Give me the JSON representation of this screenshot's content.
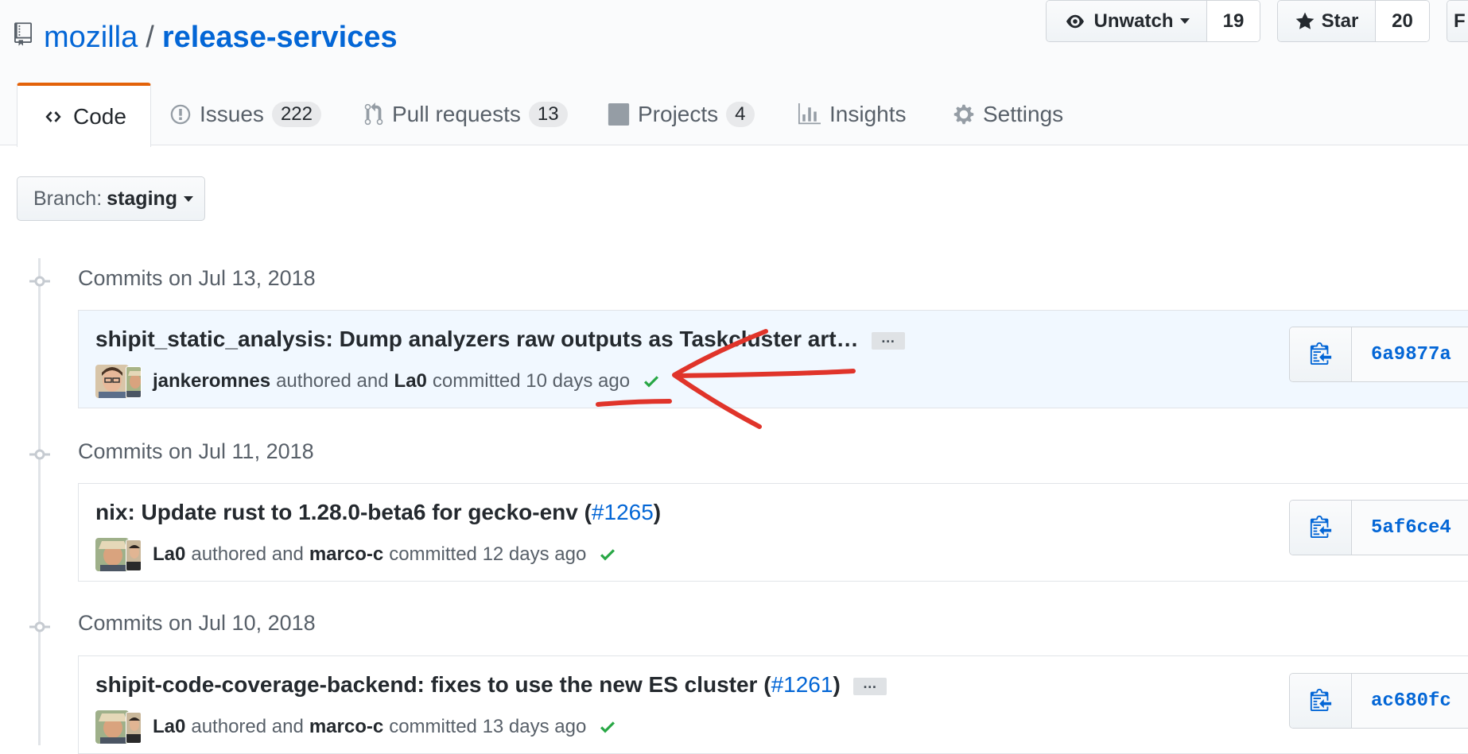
{
  "repo": {
    "owner": "mozilla",
    "separator": "/",
    "name": "release-services"
  },
  "actions": {
    "watch": {
      "label": "Unwatch",
      "count": "19"
    },
    "star": {
      "label": "Star",
      "count": "20"
    },
    "fork": {
      "label": "F"
    }
  },
  "tabs": [
    {
      "label": "Code"
    },
    {
      "label": "Issues",
      "count": "222"
    },
    {
      "label": "Pull requests",
      "count": "13"
    },
    {
      "label": "Projects",
      "count": "4"
    },
    {
      "label": "Insights"
    },
    {
      "label": "Settings"
    }
  ],
  "branch": {
    "label": "Branch:",
    "value": "staging"
  },
  "groups": [
    {
      "date": "Commits on Jul 13, 2018",
      "commit": {
        "title": "shipit_static_analysis: Dump analyzers raw outputs as Taskcluster art…",
        "pr": "",
        "has_ellipsis": true,
        "author": "jankeromnes",
        "authored_text": "authored and",
        "committer": "La0",
        "committed_text": "committed 10 days ago",
        "sha": "6a9877a"
      }
    },
    {
      "date": "Commits on Jul 11, 2018",
      "commit": {
        "title": "nix: Update rust to 1.28.0-beta6 for gecko-env (",
        "pr": "#1265",
        "title_end": ")",
        "author": "La0",
        "authored_text": "authored and",
        "committer": "marco-c",
        "committed_text": "committed 12 days ago",
        "sha": "5af6ce4"
      }
    },
    {
      "date": "Commits on Jul 10, 2018",
      "commit": {
        "title": "shipit-code-coverage-backend: fixes to use the new ES cluster (",
        "pr": "#1261",
        "title_end": ")",
        "has_ellipsis": true,
        "author": "La0",
        "authored_text": "authored and",
        "committer": "marco-c",
        "committed_text": "committed 13 days ago",
        "sha": "ac680fc"
      }
    }
  ],
  "ellipsis_label": "…",
  "colors": {
    "link": "#0366d6",
    "tab_accent": "#e36209",
    "success": "#28a745",
    "annotation": "#e0342a"
  }
}
